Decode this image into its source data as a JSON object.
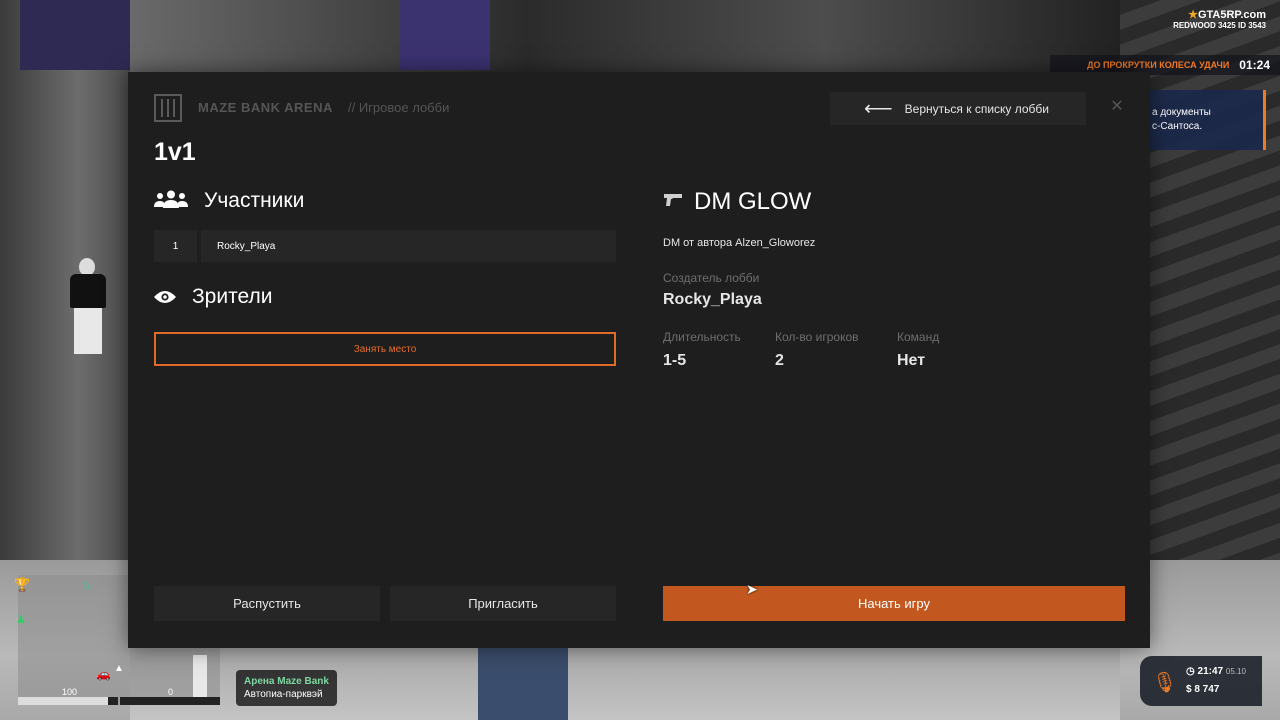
{
  "hud": {
    "brand": "GTA5RP.com",
    "server": "REDWOOD 3425 ID 3543",
    "wheel_label": "ДО ПРОКРУТКИ КОЛЕСА УДАЧИ",
    "wheel_time": "01:24",
    "notice_line1": "а документы",
    "notice_line2": "с-Сантоса.",
    "minimap_left_value": "100",
    "minimap_right_value": "0",
    "health_fraction": 0.9,
    "armor_fraction": 0.0,
    "location_line1": "Арена Maze Bank",
    "location_line2": "Автопиа-парквэй",
    "time": "21:47",
    "date": "05.10",
    "money": "$ 8 747",
    "accent_color": "#f07a22"
  },
  "lobby": {
    "venue": "MAZE BANK ARENA",
    "breadcrumb": "// Игровое лобби",
    "back_label": "Вернуться к списку лобби",
    "close_icon": "close-icon",
    "mode_title": "1v1",
    "participants_heading": "Участники",
    "players": [
      {
        "num": "1",
        "name": "Rocky_Playa"
      }
    ],
    "spectators_heading": "Зрители",
    "take_seat_label": "Занять место",
    "dm_title": "DM GLOW",
    "dm_author": "DM от автора Alzen_Gloworez",
    "creator_label": "Создатель лобби",
    "creator_value": "Rocky_Playa",
    "stats": [
      {
        "label": "Длительность",
        "value": "1-5"
      },
      {
        "label": "Кол-во игроков",
        "value": "2"
      },
      {
        "label": "Команд",
        "value": "Нет"
      }
    ],
    "disband_label": "Распустить",
    "invite_label": "Пригласить",
    "start_label": "Начать игру",
    "start_color": "#c2571f",
    "seat_border_color": "#e06a2a"
  }
}
